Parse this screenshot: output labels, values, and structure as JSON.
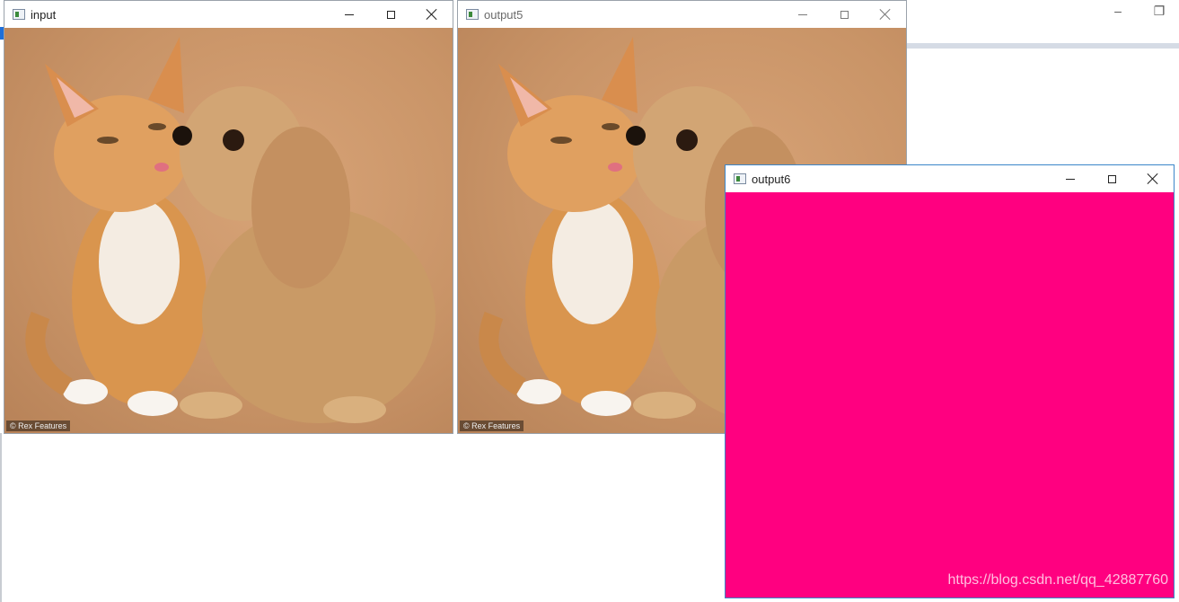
{
  "background_window": {
    "caption_controls": {
      "minimize_icon": "minimize-icon",
      "restore_icon": "restore-icon"
    }
  },
  "windows": [
    {
      "title": "input",
      "content": "photo",
      "credit": "© Rex Features"
    },
    {
      "title": "output5",
      "content": "photo",
      "credit": "© Rex Features"
    },
    {
      "title": "output6",
      "content": "solid",
      "fill_color": "#ff0080"
    }
  ],
  "watermark": "https://blog.csdn.net/qq_42887760",
  "colors": {
    "accent_blue": "#1e6fd9",
    "output6_fill": "#ff0080"
  }
}
